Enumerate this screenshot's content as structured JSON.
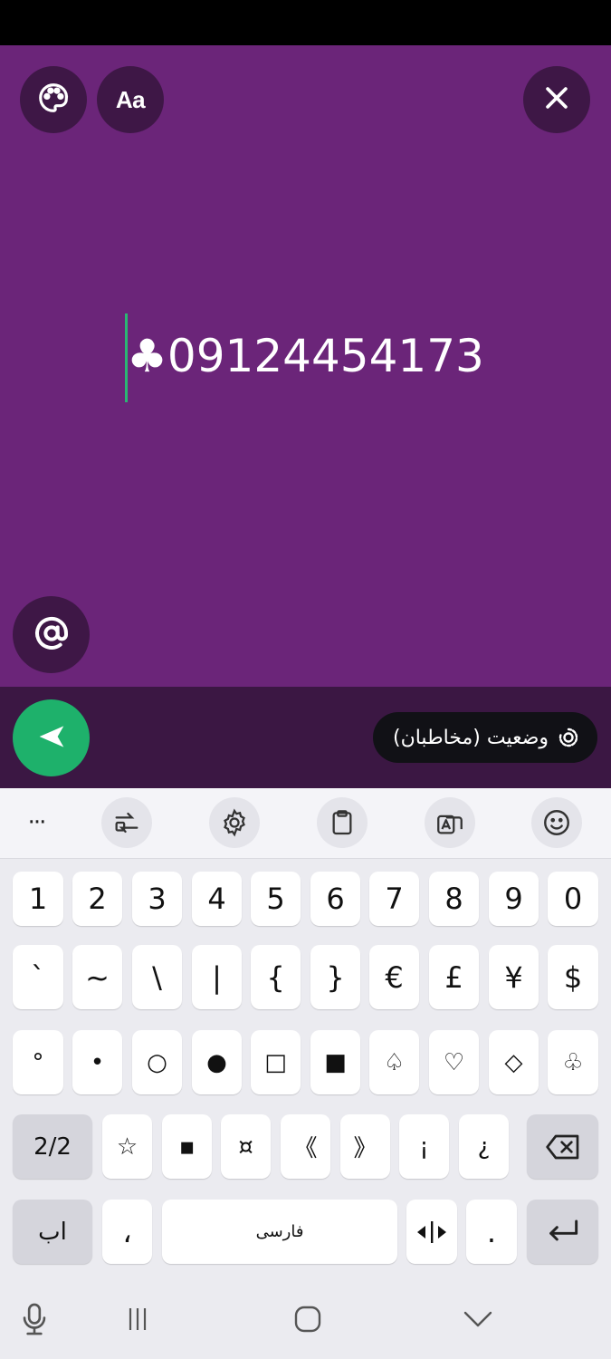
{
  "colors": {
    "compose_bg": "#6b2579",
    "compose_btn_bg": "#3e1746",
    "sendbar_bg": "#3b1743",
    "send_btn": "#1eb16b",
    "caret": "#2bb673",
    "key_bg": "#ffffff",
    "fn_key_bg": "#d5d5dc",
    "keyboard_bg": "#ebebf0"
  },
  "compose": {
    "palette_icon": "palette-icon",
    "font_button_label": "Aa",
    "close_icon": "close-icon",
    "text_value": "♣09124454173",
    "mention_icon": "at-icon"
  },
  "sendbar": {
    "send_icon": "send-arrow-icon",
    "audience_label": "وضعیت (مخاطبان)",
    "audience_icon": "status-ring-icon"
  },
  "keyboard_toolbar": {
    "items": [
      {
        "name": "more-options",
        "label": "···",
        "icon": "more-icon"
      },
      {
        "name": "swap-mode",
        "icon": "swap-icon"
      },
      {
        "name": "settings",
        "icon": "gear-icon"
      },
      {
        "name": "clipboard",
        "icon": "clipboard-icon"
      },
      {
        "name": "translate",
        "icon": "translate-icon"
      },
      {
        "name": "emoji",
        "icon": "emoji-icon"
      }
    ]
  },
  "keyboard": {
    "row1": [
      "1",
      "2",
      "3",
      "4",
      "5",
      "6",
      "7",
      "8",
      "9",
      "0"
    ],
    "row2": [
      "`",
      "~",
      "\\",
      "|",
      "{",
      "}",
      "€",
      "£",
      "¥",
      "$"
    ],
    "row3": [
      "°",
      "•",
      "○",
      "●",
      "□",
      "■",
      "♤",
      "♡",
      "◇",
      "♧"
    ],
    "row4": {
      "page_toggle": "2/2",
      "keys": [
        "☆",
        "▪",
        "¤",
        "《",
        "》",
        "¡",
        "¿"
      ],
      "backspace_icon": "backspace-icon"
    },
    "row5": {
      "language_key": "اب",
      "comma": "،",
      "space_label": "فارسی",
      "cursor_move_icon": "cursor-move-icon",
      "period": ".",
      "enter_icon": "enter-icon"
    }
  },
  "navbar": {
    "mic_icon": "mic-icon",
    "recents_icon": "recents-icon",
    "home_icon": "home-icon",
    "hide_keyboard_icon": "chevron-down-icon"
  }
}
